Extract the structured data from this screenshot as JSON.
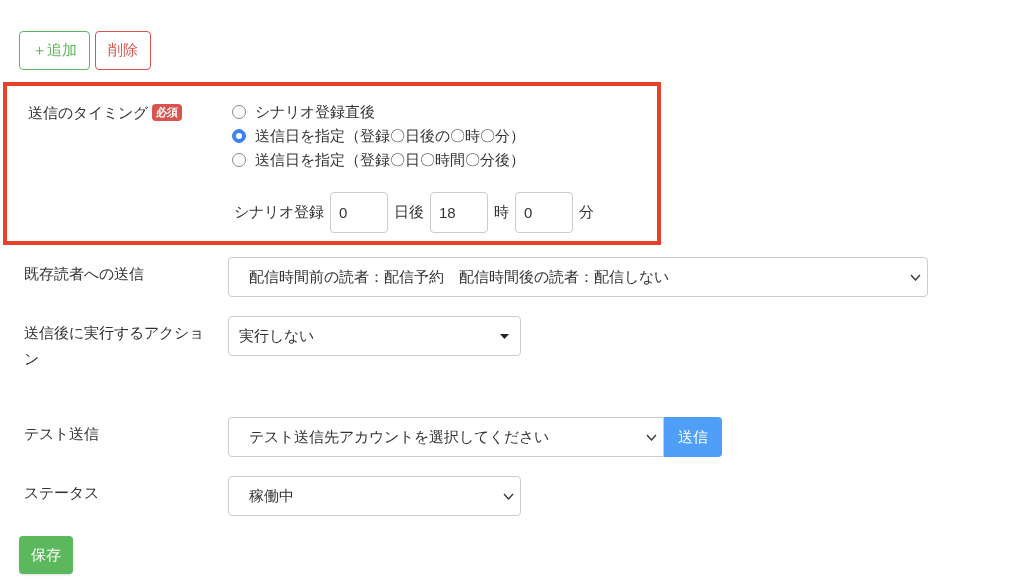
{
  "toolbar": [
    {
      "kind": "add",
      "label": "＋追加"
    },
    {
      "kind": "delete",
      "label": "削除"
    }
  ],
  "timing": {
    "label": "送信のタイミング",
    "required_badge": "必須",
    "highlighted": true,
    "options": [
      {
        "label": "シナリオ登録直後",
        "selected": false
      },
      {
        "label": "送信日を指定（登録〇日後の〇時〇分）",
        "selected": true
      },
      {
        "label": "送信日を指定（登録〇日〇時間〇分後）",
        "selected": false
      }
    ],
    "schedule": [
      {
        "kind": "text",
        "text": "シナリオ登録"
      },
      {
        "kind": "input",
        "value": "0"
      },
      {
        "kind": "text",
        "text": "日後"
      },
      {
        "kind": "input",
        "value": "18"
      },
      {
        "kind": "text",
        "text": "時"
      },
      {
        "kind": "input",
        "value": "0"
      },
      {
        "kind": "text",
        "text": "分"
      }
    ]
  },
  "fields": [
    {
      "kind": "select",
      "label": "既存読者への送信",
      "value": "配信時間前の読者：配信予約　配信時間後の読者：配信しない"
    },
    {
      "kind": "dropdown",
      "label": "送信後に実行するアクション",
      "value": "実行しない"
    },
    {
      "kind": "select_button",
      "label": "テスト送信",
      "value": "テスト送信先アカウントを選択してください",
      "button": "送信"
    },
    {
      "kind": "select",
      "label": "ステータス",
      "value": "稼働中"
    }
  ],
  "save_button": "保存"
}
